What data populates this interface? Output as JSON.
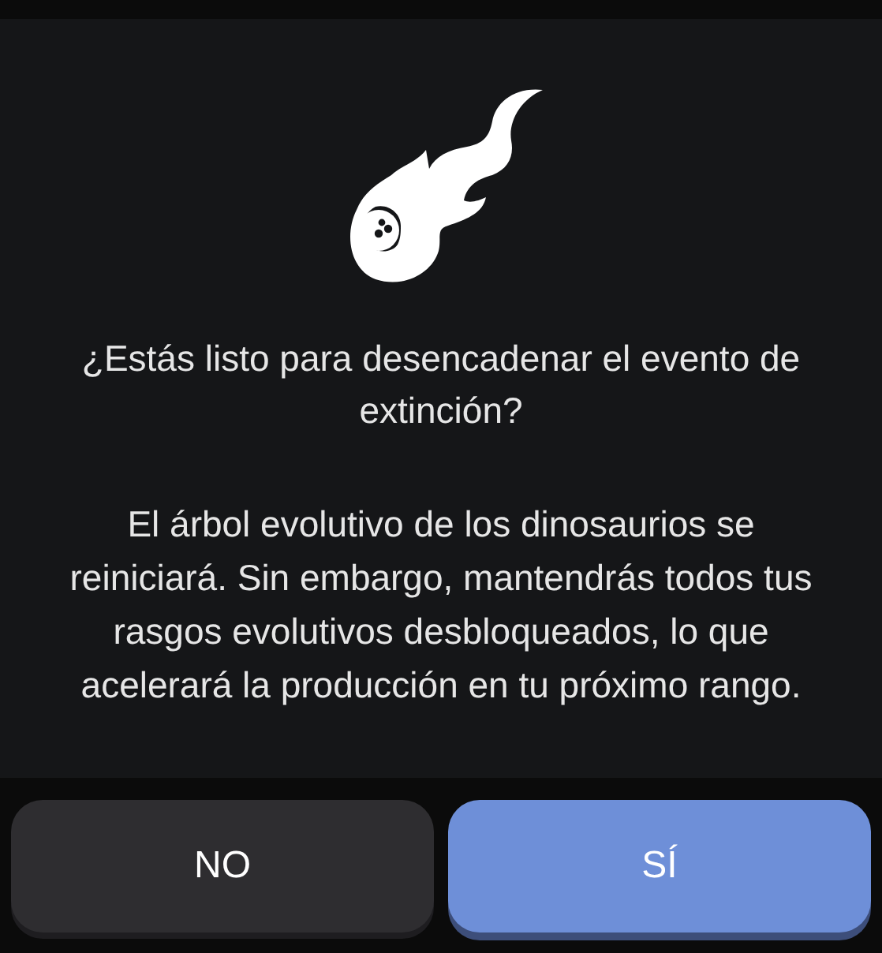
{
  "dialog": {
    "question": "¿Estás listo para desencadenar el evento de extinción?",
    "message": "El árbol evolutivo de los dinosaurios se reiniciará. Sin embargo, mantendrás todos tus rasgos evolutivos desbloqueados, lo que acelerará la producción en tu próximo rango."
  },
  "buttons": [
    {
      "label": "NO",
      "kind": "secondary"
    },
    {
      "label": "SÍ",
      "kind": "primary"
    }
  ]
}
